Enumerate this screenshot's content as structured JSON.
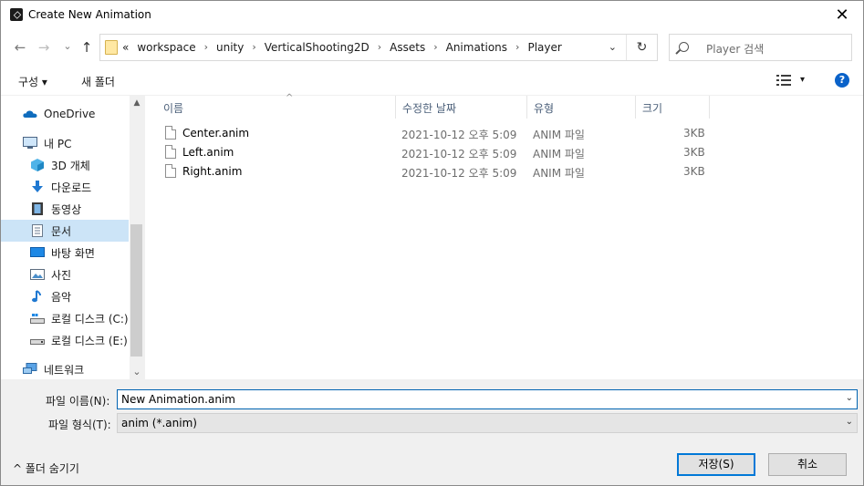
{
  "window": {
    "title": "Create New Animation",
    "close_glyph": "✕"
  },
  "nav": {
    "back_glyph": "←",
    "forward_glyph": "→",
    "recent_glyph": "⌄",
    "up_glyph": "↑",
    "overflow": "«",
    "breadcrumbs": [
      "workspace",
      "unity",
      "VerticalShooting2D",
      "Assets",
      "Animations",
      "Player"
    ],
    "separator": "›",
    "dropdown_glyph": "⌄",
    "refresh_glyph": "↻",
    "search_placeholder": "Player 검색"
  },
  "toolbar": {
    "organize_label": "구성 ▾",
    "new_folder_label": "새 폴더",
    "view_dropdown_glyph": "▾",
    "help_glyph": "?"
  },
  "sidebar": {
    "items": [
      {
        "label": "OneDrive",
        "icon": "cloud-icon"
      },
      {
        "label": "내 PC",
        "icon": "computer-icon"
      },
      {
        "label": "3D 개체",
        "icon": "cube-icon"
      },
      {
        "label": "다운로드",
        "icon": "download-icon"
      },
      {
        "label": "동영상",
        "icon": "video-icon"
      },
      {
        "label": "문서",
        "icon": "document-icon",
        "selected": true
      },
      {
        "label": "바탕 화면",
        "icon": "desktop-icon"
      },
      {
        "label": "사진",
        "icon": "picture-icon"
      },
      {
        "label": "음악",
        "icon": "music-icon"
      },
      {
        "label": "로컬 디스크 (C:)",
        "icon": "drive-icon"
      },
      {
        "label": "로컬 디스크 (E:)",
        "icon": "drive-icon"
      },
      {
        "label": "네트워크",
        "icon": "network-icon"
      }
    ],
    "scroll_up_glyph": "▲",
    "scroll_down_glyph": "⌄"
  },
  "filelist": {
    "columns": [
      "이름",
      "수정한 날짜",
      "유형",
      "크기"
    ],
    "sort_glyph": "^",
    "rows": [
      {
        "name": "Center.anim",
        "modified": "2021-10-12 오후 5:09",
        "type": "ANIM 파일",
        "size": "3KB"
      },
      {
        "name": "Left.anim",
        "modified": "2021-10-12 오후 5:09",
        "type": "ANIM 파일",
        "size": "3KB"
      },
      {
        "name": "Right.anim",
        "modified": "2021-10-12 오후 5:09",
        "type": "ANIM 파일",
        "size": "3KB"
      }
    ]
  },
  "bottom": {
    "filename_label": "파일 이름(N):",
    "filename_value": "New Animation.anim",
    "filetype_label": "파일 형식(T):",
    "filetype_value": "anim (*.anim)",
    "dropdown_glyph": "⌄",
    "hide_folders_label": "^  폴더 숨기기",
    "save_label": "저장(S)",
    "cancel_label": "취소"
  },
  "colors": {
    "accent": "#0078d7",
    "selection": "#cce4f7",
    "help": "#0a62c9"
  }
}
